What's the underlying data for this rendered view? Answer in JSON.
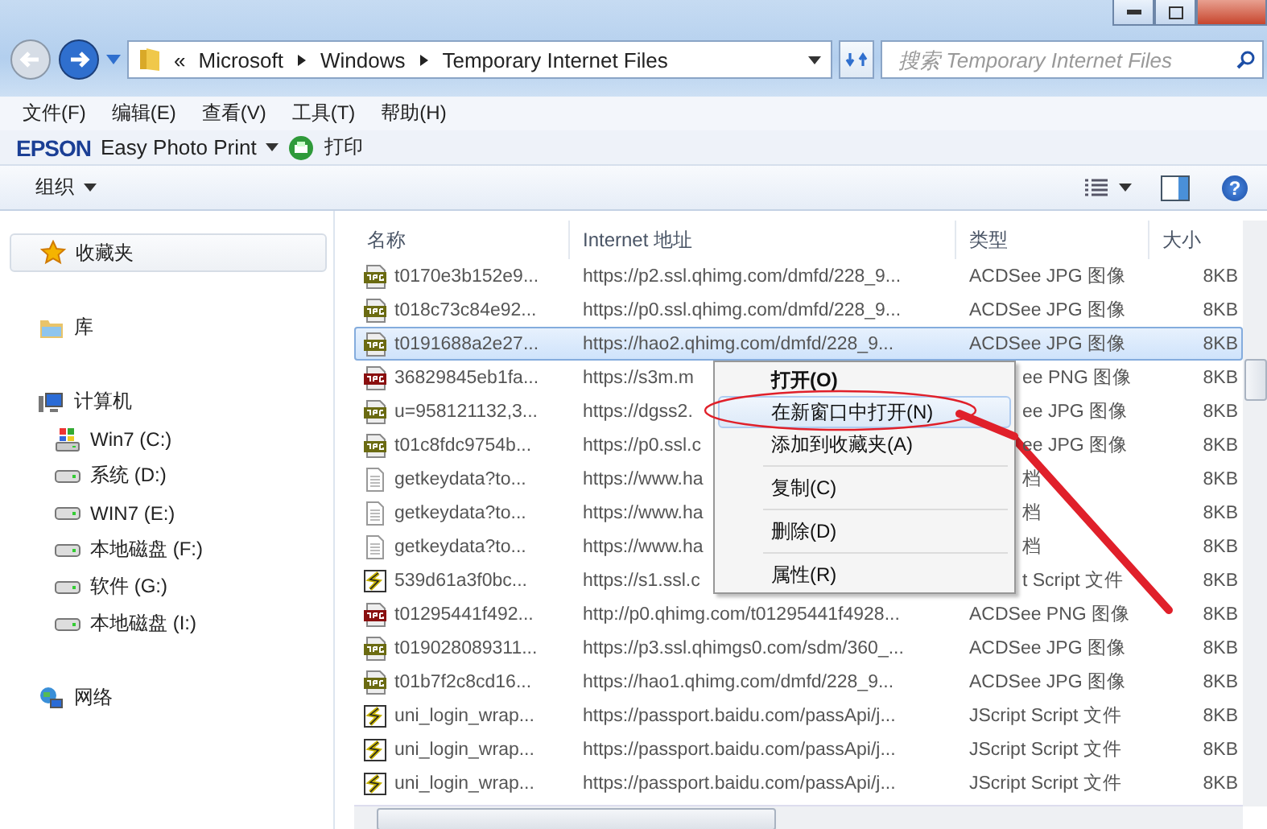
{
  "address_bar": {
    "segments": [
      "«",
      "Microsoft",
      "Windows",
      "Temporary Internet Files"
    ]
  },
  "search": {
    "placeholder": "搜索 Temporary Internet Files"
  },
  "menu_bar": [
    "文件(F)",
    "编辑(E)",
    "查看(V)",
    "工具(T)",
    "帮助(H)"
  ],
  "epson_toolbar": {
    "logo": "EPSON",
    "app": "Easy Photo Print",
    "print": "打印"
  },
  "command_bar": {
    "organize": "组织",
    "help": "?"
  },
  "sidebar": [
    {
      "kind": "favorites",
      "label": "收藏夹"
    },
    {
      "kind": "library",
      "label": "库"
    },
    {
      "kind": "computer",
      "label": "计算机",
      "children": [
        {
          "kind": "system-drive",
          "label": "Win7 (C:)"
        },
        {
          "kind": "drive",
          "label": "系统 (D:)"
        },
        {
          "kind": "drive",
          "label": "WIN7 (E:)"
        },
        {
          "kind": "drive",
          "label": "本地磁盘 (F:)"
        },
        {
          "kind": "drive",
          "label": "软件 (G:)"
        },
        {
          "kind": "drive",
          "label": "本地磁盘 (I:)"
        }
      ]
    },
    {
      "kind": "network",
      "label": "网络"
    }
  ],
  "table": {
    "columns": [
      "名称",
      "Internet 地址",
      "类型",
      "大小"
    ],
    "rows": [
      {
        "kind": "jpg",
        "name": "t0170e3b152e9...",
        "url": "https://p2.ssl.qhimg.com/dmfd/228_9...",
        "type": "ACDSee JPG 图像",
        "size": "8KB",
        "selected": false,
        "covered": false
      },
      {
        "kind": "jpg",
        "name": "t018c73c84e92...",
        "url": "https://p0.ssl.qhimg.com/dmfd/228_9...",
        "type": "ACDSee JPG 图像",
        "size": "8KB",
        "selected": false,
        "covered": false
      },
      {
        "kind": "jpg",
        "name": "t0191688a2e27...",
        "url": "https://hao2.qhimg.com/dmfd/228_9...",
        "type": "ACDSee JPG 图像",
        "size": "8KB",
        "selected": true,
        "covered": false
      },
      {
        "kind": "png",
        "name": "36829845eb1fa...",
        "url": "https://s3m.m",
        "type": "ee PNG 图像",
        "size": "8KB",
        "selected": false,
        "covered": true
      },
      {
        "kind": "jpg",
        "name": "u=958121132,3...",
        "url": "https://dgss2.",
        "type": "ee JPG 图像",
        "size": "8KB",
        "selected": false,
        "covered": true
      },
      {
        "kind": "jpg",
        "name": "t01c8fdc9754b...",
        "url": "https://p0.ssl.c",
        "type": "ee JPG 图像",
        "size": "8KB",
        "selected": false,
        "covered": true
      },
      {
        "kind": "text",
        "name": "getkeydata?to...",
        "url": "https://www.ha",
        "type": "档",
        "size": "8KB",
        "selected": false,
        "covered": true
      },
      {
        "kind": "text",
        "name": "getkeydata?to...",
        "url": "https://www.ha",
        "type": "档",
        "size": "8KB",
        "selected": false,
        "covered": true
      },
      {
        "kind": "text",
        "name": "getkeydata?to...",
        "url": "https://www.ha",
        "type": "档",
        "size": "8KB",
        "selected": false,
        "covered": true
      },
      {
        "kind": "script",
        "name": "539d61a3f0bc...",
        "url": "https://s1.ssl.c",
        "type": "t Script 文件",
        "size": "8KB",
        "selected": false,
        "covered": true
      },
      {
        "kind": "png",
        "name": "t01295441f492...",
        "url": "http://p0.qhimg.com/t01295441f4928...",
        "type": "ACDSee PNG 图像",
        "size": "8KB",
        "selected": false,
        "covered": false
      },
      {
        "kind": "jpg",
        "name": "t019028089311...",
        "url": "https://p3.ssl.qhimgs0.com/sdm/360_...",
        "type": "ACDSee JPG 图像",
        "size": "8KB",
        "selected": false,
        "covered": false
      },
      {
        "kind": "jpg",
        "name": "t01b7f2c8cd16...",
        "url": "https://hao1.qhimg.com/dmfd/228_9...",
        "type": "ACDSee JPG 图像",
        "size": "8KB",
        "selected": false,
        "covered": false
      },
      {
        "kind": "script",
        "name": "uni_login_wrap...",
        "url": "https://passport.baidu.com/passApi/j...",
        "type": "JScript Script 文件",
        "size": "8KB",
        "selected": false,
        "covered": false
      },
      {
        "kind": "script",
        "name": "uni_login_wrap...",
        "url": "https://passport.baidu.com/passApi/j...",
        "type": "JScript Script 文件",
        "size": "8KB",
        "selected": false,
        "covered": false
      },
      {
        "kind": "script",
        "name": "uni_login_wrap...",
        "url": "https://passport.baidu.com/passApi/j...",
        "type": "JScript Script 文件",
        "size": "8KB",
        "selected": false,
        "covered": false
      }
    ]
  },
  "context_menu": [
    {
      "kind": "item",
      "label": "打开(O)",
      "default": true,
      "selected": false
    },
    {
      "kind": "item",
      "label": "在新窗口中打开(N)",
      "default": false,
      "selected": true
    },
    {
      "kind": "item",
      "label": "添加到收藏夹(A)",
      "default": false,
      "selected": false
    },
    {
      "kind": "separator"
    },
    {
      "kind": "item",
      "label": "复制(C)",
      "default": false,
      "selected": false
    },
    {
      "kind": "separator"
    },
    {
      "kind": "item",
      "label": "删除(D)",
      "default": false,
      "selected": false
    },
    {
      "kind": "separator"
    },
    {
      "kind": "item",
      "label": "属性(R)",
      "default": false,
      "selected": false
    }
  ]
}
